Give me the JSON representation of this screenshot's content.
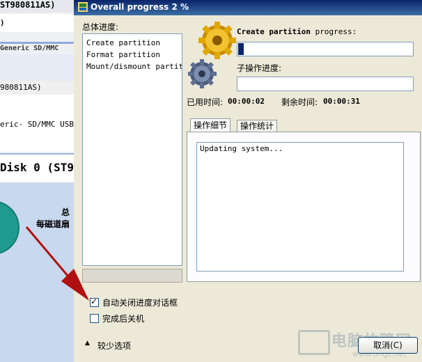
{
  "background_app": {
    "title_fragment": "ST980811AS)",
    "drive1_fragment": ")",
    "scroll_fragment": "Generic SD/MMC",
    "drive2_fragment": "980811AS)",
    "card_fragment": "eric- SD/MMC USB",
    "disk_fragment": "Disk 0 (ST98",
    "stat1_fragment": "总",
    "stat2_fragment": "每磁道扇"
  },
  "dialog": {
    "title": "Overall progress 2 %",
    "overall_label": "总体进度:",
    "steps": [
      "Create partition",
      "Format partition",
      "Mount/dismount partitio"
    ],
    "current_op_bold": "Create partition",
    "current_op_suffix": " progress:",
    "main_progress_percent": 2,
    "sub_label": "子操作进度:",
    "elapsed_label": "已用时间:",
    "elapsed_value": "00:00:02",
    "remaining_label": "剩余时间:",
    "remaining_value": "00:00:31",
    "tabs": [
      "操作细节",
      "操作统计"
    ],
    "log_text": "Updating system...",
    "auto_close_label": "自动关闭进度对话框",
    "auto_close_checked": true,
    "shutdown_label": "完成后关机",
    "shutdown_checked": false,
    "fewer_options_label": "较少选项",
    "cancel_label": "取消(C)"
  },
  "watermark": {
    "title": "电脑故障网",
    "url": "www.dngz.net"
  },
  "colors": {
    "titlebar": "#0a246a",
    "dialog_bg": "#ece9d8",
    "progress_fill": "#0a246a",
    "arrow": "#b01010"
  }
}
